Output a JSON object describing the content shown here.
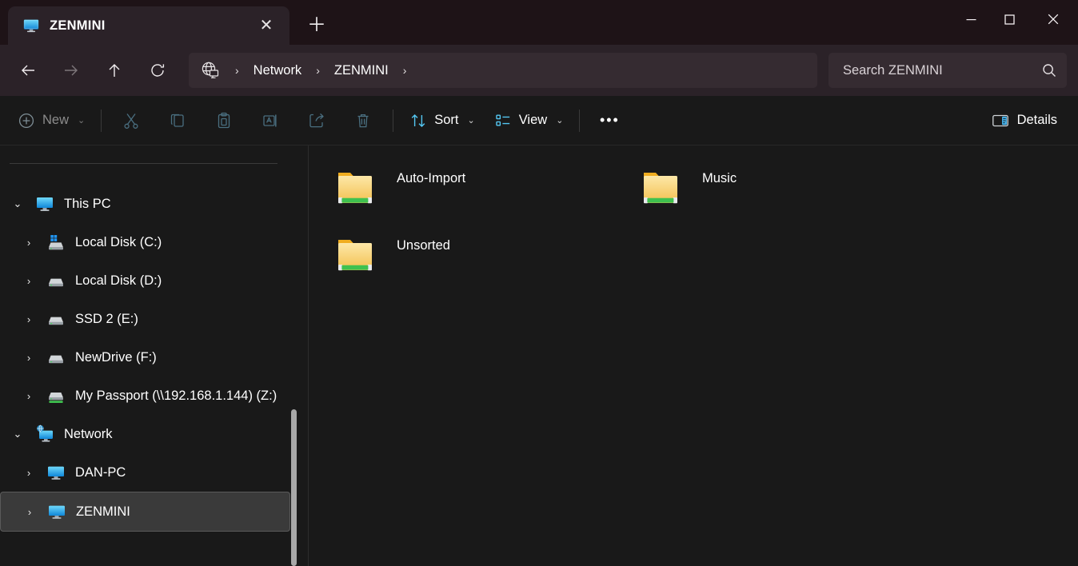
{
  "window": {
    "tab": {
      "title": "ZENMINI",
      "icon": "monitor-icon",
      "close_label": "✕"
    },
    "new_tab_label": "＋",
    "controls": {
      "minimize": "—",
      "maximize": "□",
      "close": "✕"
    }
  },
  "navigation": {
    "back": "back-arrow-icon",
    "forward": "forward-arrow-icon",
    "up": "up-arrow-icon",
    "refresh": "refresh-icon",
    "breadcrumb": {
      "icon": "network-globe-icon",
      "separator": "›",
      "items": [
        "Network",
        "ZENMINI"
      ],
      "trailing_separator": "›"
    }
  },
  "search": {
    "placeholder": "Search ZENMINI",
    "icon": "search-icon"
  },
  "toolbar": {
    "new_label": "New",
    "new_chevron": "⌄",
    "cut_label": "Cut",
    "copy_label": "Copy",
    "paste_label": "Paste",
    "rename_label": "Rename",
    "share_label": "Share",
    "delete_label": "Delete",
    "sort_label": "Sort",
    "sort_chevron": "⌄",
    "view_label": "View",
    "view_chevron": "⌄",
    "more_label": "•••",
    "details_label": "Details"
  },
  "sidebar": {
    "items": [
      {
        "label": "This PC",
        "icon": "monitor-icon",
        "twisty": "⌄",
        "expanded": true,
        "level": 0,
        "selected": false
      },
      {
        "label": "Local Disk (C:)",
        "icon": "windows-disk-icon",
        "twisty": "›",
        "expanded": false,
        "level": 1,
        "selected": false
      },
      {
        "label": "Local Disk (D:)",
        "icon": "disk-icon",
        "twisty": "›",
        "expanded": false,
        "level": 1,
        "selected": false
      },
      {
        "label": "SSD 2 (E:)",
        "icon": "disk-icon",
        "twisty": "›",
        "expanded": false,
        "level": 1,
        "selected": false
      },
      {
        "label": "NewDrive (F:)",
        "icon": "disk-icon",
        "twisty": "›",
        "expanded": false,
        "level": 1,
        "selected": false
      },
      {
        "label": "My Passport (\\\\192.168.1.144) (Z:)",
        "icon": "network-disk-icon",
        "twisty": "›",
        "expanded": false,
        "level": 1,
        "selected": false
      },
      {
        "label": "Network",
        "icon": "network-icon",
        "twisty": "⌄",
        "expanded": true,
        "level": 0,
        "selected": false
      },
      {
        "label": "DAN-PC",
        "icon": "monitor-icon",
        "twisty": "›",
        "expanded": false,
        "level": 1,
        "selected": false
      },
      {
        "label": "ZENMINI",
        "icon": "monitor-icon",
        "twisty": "›",
        "expanded": false,
        "level": 1,
        "selected": true
      }
    ]
  },
  "content": {
    "items": [
      {
        "name": "Auto-Import",
        "icon": "shared-folder-icon"
      },
      {
        "name": "Music",
        "icon": "shared-folder-icon"
      },
      {
        "name": "Unsorted",
        "icon": "shared-folder-icon"
      }
    ]
  },
  "colors": {
    "titlebar_bg": "#1e1317",
    "addressbar_bg": "#2b2228",
    "app_bg": "#191919",
    "field_bg": "#352b31",
    "accent_blue": "#4cc2ff",
    "folder_yellow": "#f5c33b",
    "share_green": "#3fc14f",
    "selection_bg": "#3a3a3a",
    "text": "#ffffff"
  }
}
